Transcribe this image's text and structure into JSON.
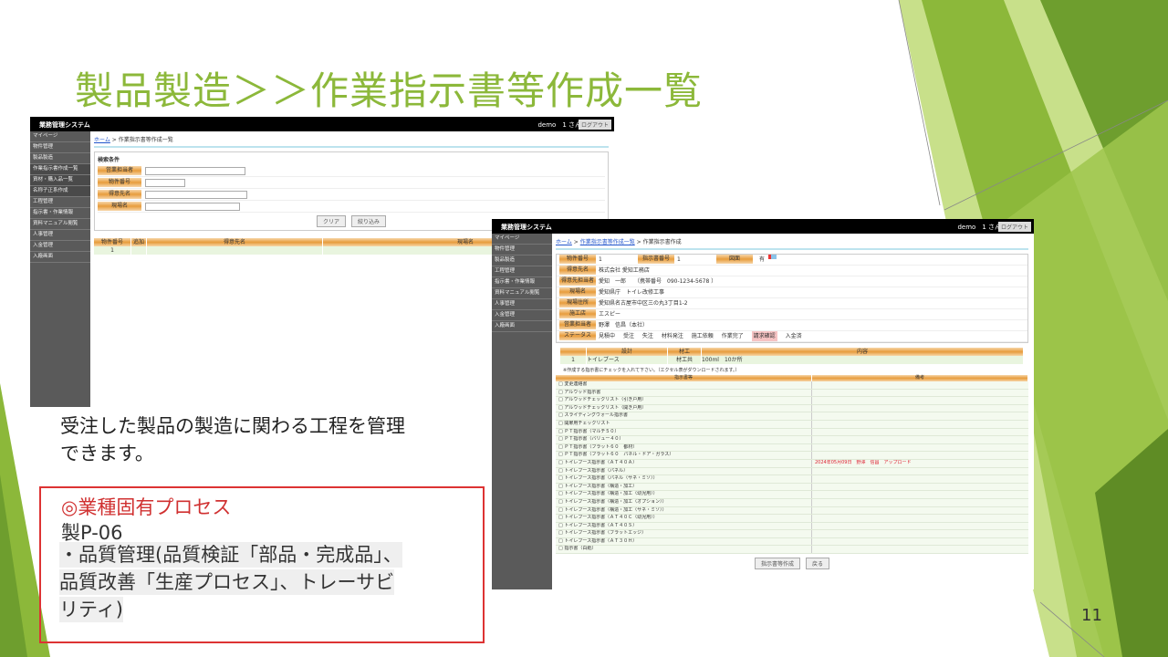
{
  "slide": {
    "title": "製品製造＞＞作業指示書等作成一覧",
    "description_line1": "受注した製品の製造に関わる工程を管理",
    "description_line2": "できます。",
    "process": {
      "heading": "◎業種固有プロセス",
      "code": "製P-06",
      "line1": "・品質管理(品質検証「部品・完成品」、",
      "line2": "品質改善「生産プロセス」、トレーサビ",
      "line3": "リティ)"
    },
    "page_number": "11",
    "colors": {
      "title": "#8cb83a",
      "accent_green": "#8cb83a",
      "box_border": "#d33333"
    }
  },
  "app": {
    "name": "業務管理システム",
    "user": "demo　1 さん",
    "logout": "ログアウト"
  },
  "sidebar1": [
    "マイページ",
    "物件管理",
    "製品製造",
    "作業指示書作成一覧",
    "資材・購入品一覧",
    "名称子正系作成",
    "工程管理",
    "指示書・作業情報",
    "資料マニュアル閲覧",
    "人事管理",
    "入金管理",
    "入廠画面"
  ],
  "sidebar2": [
    "マイページ",
    "物件管理",
    "製品製造",
    "工程管理",
    "指示書・作業情報",
    "資料マニュアル閲覧",
    "人事管理",
    "入金管理",
    "入廠画面"
  ],
  "screen1": {
    "breadcrumb_home": "ホーム",
    "breadcrumb_sep": ">",
    "breadcrumb_current": "作業指示書等作成一覧",
    "search_title": "検索条件",
    "fields": [
      "営業担当者",
      "物件番号",
      "得意先名",
      "現場名"
    ],
    "btn_clear": "クリア",
    "btn_filter": "絞り込み",
    "columns": [
      "物件番号",
      "追加",
      "得意先名",
      "現場名"
    ],
    "row": [
      "1",
      "",
      "",
      ""
    ]
  },
  "screen2": {
    "breadcrumb_home": "ホーム",
    "breadcrumb_list": "作業指示書等作成一覧",
    "breadcrumb_current": "作業指示書作成",
    "labels": {
      "property_no": "物件番号",
      "instruction_no": "指示書番号",
      "drawing": "図面",
      "client": "得意先名",
      "client_person": "得意先担当者",
      "site": "現場名",
      "site_address": "現場住所",
      "contractor": "施工店",
      "sales_rep": "営業担当者",
      "status": "ステータス"
    },
    "values": {
      "property_no": "1",
      "instruction_no": "1",
      "drawing_flag": "有",
      "client": "株式会社 愛知工務店",
      "client_person": "愛知　一郎　　（携帯番号　090-1234-5678 ）",
      "site": "愛知県庁　トイレ改修工事",
      "site_address": "愛知県名古屋市中区三の丸3丁目1-2",
      "contractor": "エスピー",
      "sales_rep": "野澤　信昌（本社）"
    },
    "statuses": [
      "見積中",
      "受注",
      "失注",
      "材料発注",
      "施工依頼",
      "作業完了",
      "請求確認",
      "入金済"
    ],
    "active_status": "請求確認",
    "spec_columns": [
      "",
      "設計",
      "材工",
      "内容"
    ],
    "spec_row": [
      "1",
      "トイレブース",
      "材工共",
      "100ml　10か所"
    ],
    "instruction_note": "※作成する指示書にチェックを入れて下さい。（エクセル表がダウンロードされます。）",
    "doc_columns": [
      "指示書等",
      "備考"
    ],
    "docs": [
      {
        "name": "□ 変更連絡書",
        "note": ""
      },
      {
        "name": "□ アルウッド指示書",
        "note": ""
      },
      {
        "name": "□ アルウッドチェックリスト（引き戸用）",
        "note": ""
      },
      {
        "name": "□ アルウッドチェックリスト（開き戸用）",
        "note": ""
      },
      {
        "name": "□ スライディングウォール指示書",
        "note": ""
      },
      {
        "name": "□ 開扉用チェックリスト",
        "note": ""
      },
      {
        "name": "□ ＰＴ指示書（マルチ５０）",
        "note": ""
      },
      {
        "name": "□ ＰＴ指示書（バリュー４０）",
        "note": ""
      },
      {
        "name": "□ ＰＴ指示書（フラット６０　都材）",
        "note": ""
      },
      {
        "name": "□ ＰＴ指示書（フラット６０　パネル・ドア・ガラス）",
        "note": ""
      },
      {
        "name": "□ トイレブース指示書（ＡＴ４０Ａ）",
        "note": "2024年05月09日　野澤　信昌　アップロード"
      },
      {
        "name": "□ トイレブース指示書（パネル）",
        "note": ""
      },
      {
        "name": "□ トイレブース指示書（パネル（サネ・ミゾ））",
        "note": ""
      },
      {
        "name": "□ トイレブース指示書（構造・加工）",
        "note": ""
      },
      {
        "name": "□ トイレブース指示書（構造・加工（幼児用））",
        "note": ""
      },
      {
        "name": "□ トイレブース指示書（構造・加工（オプション））",
        "note": ""
      },
      {
        "name": "□ トイレブース指示書（構造・加工（サネ・ミゾ））",
        "note": ""
      },
      {
        "name": "□ トイレブース指示書（ＡＴ４０Ｃ（幼児用））",
        "note": ""
      },
      {
        "name": "□ トイレブース指示書（ＡＴ４０Ｓ）",
        "note": ""
      },
      {
        "name": "□ トイレブース指示書（フラットエッジ）",
        "note": ""
      },
      {
        "name": "□ トイレブース指示書（ＡＴ３０Ｈ）",
        "note": ""
      },
      {
        "name": "□ 指示書（白紙）",
        "note": ""
      }
    ],
    "btn_create": "指示書等作成",
    "btn_back": "戻る"
  }
}
